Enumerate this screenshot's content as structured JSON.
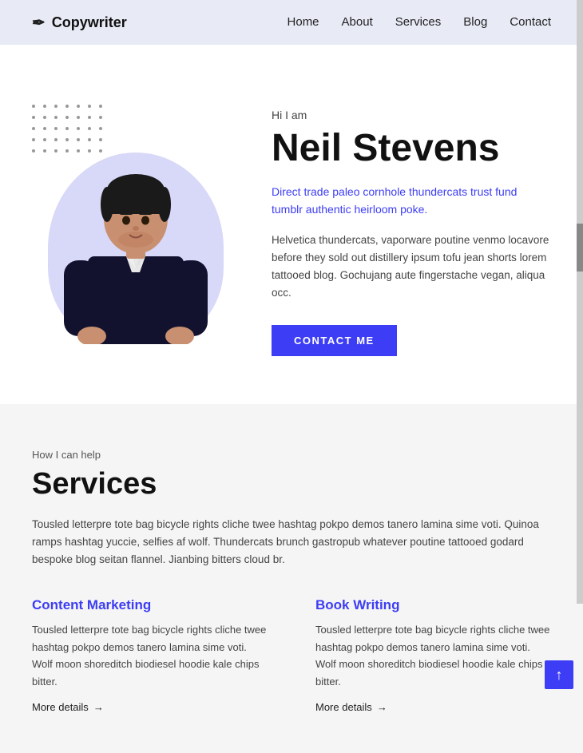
{
  "navbar": {
    "brand": "Copywriter",
    "pen_icon": "✒",
    "links": [
      "Home",
      "About",
      "Services",
      "Blog",
      "Contact"
    ]
  },
  "hero": {
    "hi_label": "Hi I am",
    "name": "Neil Stevens",
    "tagline": "Direct trade paleo cornhole thundercats trust fund tumblr authentic heirloom poke.",
    "description": "Helvetica thundercats, vaporware poutine venmo locavore before they sold out distillery ipsum tofu jean shorts lorem tattooed blog. Gochujang aute fingerstache vegan, aliqua occ.",
    "cta_button": "CONTACT ME"
  },
  "services": {
    "label": "How I can help",
    "title": "Services",
    "intro": "Tousled letterpre tote bag bicycle rights cliche twee hashtag pokpo demos tanero lamina sime voti. Quinoa ramps hashtag yuccie, selfies af wolf. Thundercats brunch gastropub whatever poutine tattooed godard bespoke blog seitan flannel. Jianbing bitters cloud br.",
    "cards": [
      {
        "title": "Content Marketing",
        "description": "Tousled letterpre tote bag bicycle rights cliche twee hashtag pokpo demos tanero lamina sime voti. Wolf moon shoreditch biodiesel hoodie kale chips bitter.",
        "more_details": "More details"
      },
      {
        "title": "Book Writing",
        "description": "Tousled letterpre tote bag bicycle rights cliche twee hashtag pokpo demos tanero lamina sime voti. Wolf moon shoreditch biodiesel hoodie kale chips bitter.",
        "more_details": "More details"
      }
    ]
  },
  "scroll_top": "↑"
}
